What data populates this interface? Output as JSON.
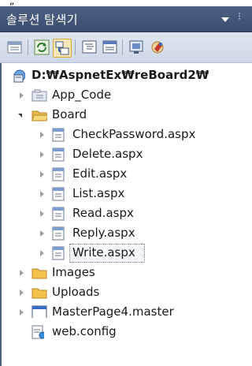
{
  "window": {
    "title": "솔루션 탐색기",
    "top_glyph": "„"
  },
  "toolbar": {
    "buttons": [
      {
        "icon": "properties-icon"
      },
      {
        "icon": "refresh-icon"
      },
      {
        "icon": "nest-related-files-icon"
      },
      {
        "icon": "view-code-icon"
      },
      {
        "icon": "view-designer-icon"
      },
      {
        "icon": "copy-website-icon"
      },
      {
        "icon": "asp-net-configuration-icon"
      }
    ]
  },
  "tree": {
    "root": {
      "label": "D:₩AspnetEx₩reBoard2₩"
    },
    "items": [
      {
        "label": "App_Code",
        "type": "special-folder",
        "expanded": false
      },
      {
        "label": "Board",
        "type": "folder",
        "expanded": true,
        "children": [
          {
            "label": "CheckPassword.aspx"
          },
          {
            "label": "Delete.aspx"
          },
          {
            "label": "Edit.aspx"
          },
          {
            "label": "List.aspx"
          },
          {
            "label": "Read.aspx"
          },
          {
            "label": "Reply.aspx"
          },
          {
            "label": "Write.aspx",
            "selected": true
          }
        ]
      },
      {
        "label": "Images",
        "type": "folder",
        "expanded": false
      },
      {
        "label": "Uploads",
        "type": "folder",
        "expanded": false
      },
      {
        "label": "MasterPage4.master",
        "type": "master-file",
        "expanded": false
      },
      {
        "label": "web.config",
        "type": "config-file"
      }
    ]
  },
  "colors": {
    "titlebar": "#4d6183",
    "toolbar": "#dfe6f1",
    "folder": "#f3c24b",
    "selection_border": "#808080"
  }
}
